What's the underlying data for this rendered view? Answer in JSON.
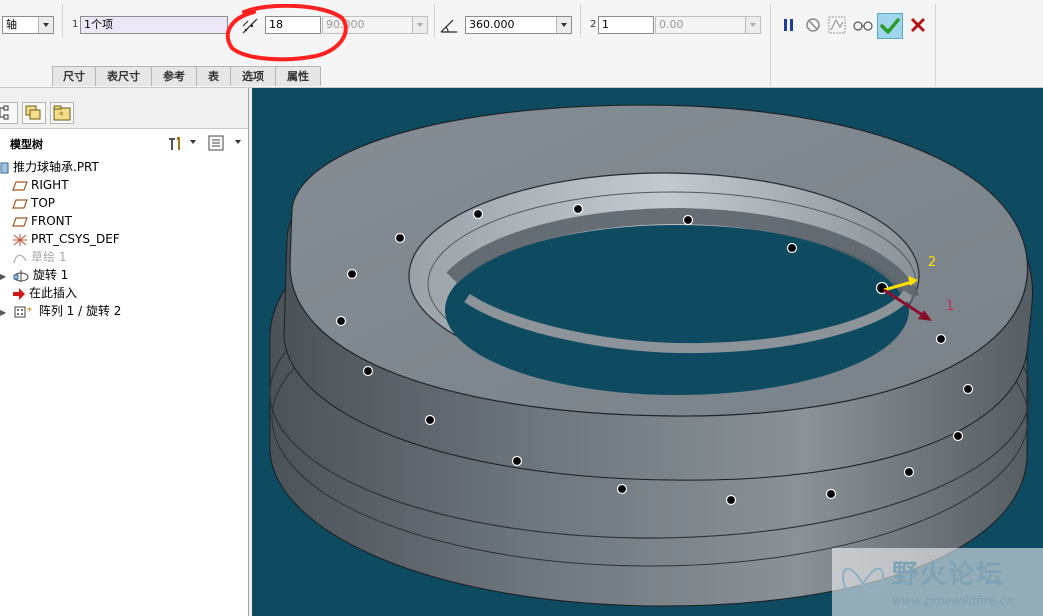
{
  "dashboard": {
    "pattern_type": "轴",
    "axis_num": "1",
    "axis_ref": "1个项",
    "count1": "18",
    "spacing1": "90.000",
    "angle_extent": "360.000",
    "dir2_num": "2",
    "count2": "1",
    "spacing2": "0.00",
    "tabs": [
      {
        "label": "尺寸"
      },
      {
        "label": "表尺寸"
      },
      {
        "label": "参考"
      },
      {
        "label": "表"
      },
      {
        "label": "选项"
      },
      {
        "label": "属性"
      }
    ]
  },
  "panel": {
    "title": "模型树"
  },
  "tree": {
    "items": [
      {
        "label": "推力球轴承.PRT",
        "icon": "part-icon"
      },
      {
        "label": "RIGHT",
        "icon": "datum-plane-icon"
      },
      {
        "label": "TOP",
        "icon": "datum-plane-icon"
      },
      {
        "label": "FRONT",
        "icon": "datum-plane-icon"
      },
      {
        "label": "PRT_CSYS_DEF",
        "icon": "csys-icon"
      },
      {
        "label": "草绘 1",
        "icon": "sketch-icon"
      },
      {
        "label": "旋转 1",
        "icon": "revolve-icon"
      },
      {
        "label": "在此插入",
        "icon": "insert-here-arrow-icon"
      },
      {
        "label": "阵列 1 / 旋转 2",
        "icon": "pattern-icon"
      }
    ]
  },
  "viewport": {
    "axis_labels": [
      "2",
      "1"
    ],
    "pattern_points": 18
  },
  "watermark": {
    "text": "野火论坛",
    "url": "www.proewildfire.cn"
  },
  "colors": {
    "viewport_bg": "#0f4b60",
    "part": "#7d858c",
    "annotation_red": "#ff2020",
    "ok_green": "#2a9a2a",
    "cancel_red": "#b01616"
  }
}
